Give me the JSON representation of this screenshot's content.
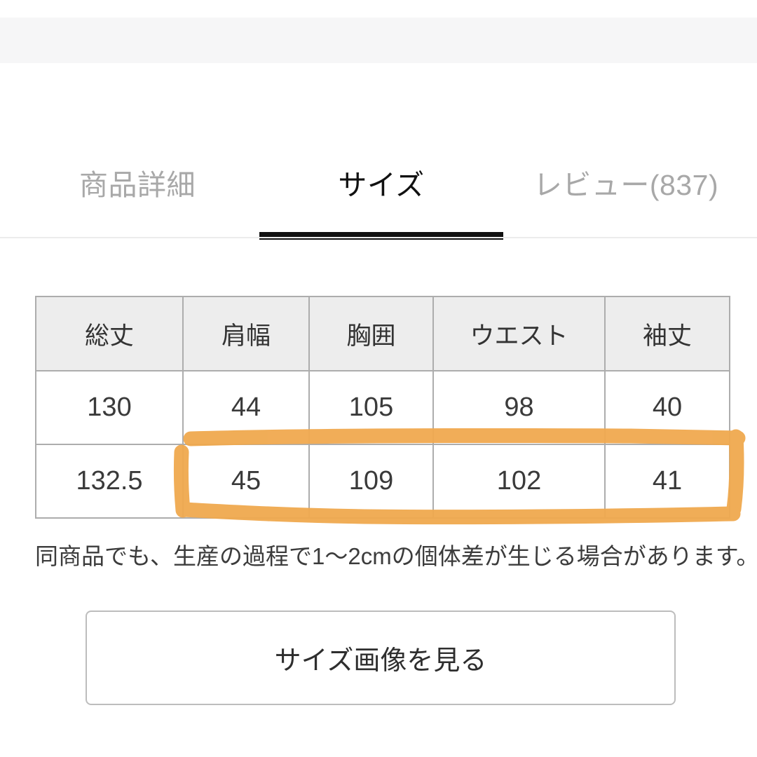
{
  "page": {
    "title": "商品サイズ",
    "background_color": "#ffffff"
  },
  "top_band": {
    "background_color": "#f6f6f7"
  },
  "tabs": {
    "active_index": 1,
    "active_color": "#111111",
    "inactive_color": "#a8a8a8",
    "items": [
      {
        "label": "商品詳細",
        "active": false
      },
      {
        "label": "サイズ",
        "active": true
      },
      {
        "label": "レビュー(837)",
        "active": false
      }
    ]
  },
  "size_table": {
    "headers": [
      "総丈",
      "肩幅",
      "胸囲",
      "ウエスト",
      "袖丈"
    ],
    "rows": [
      [
        "130",
        "44",
        "105",
        "98",
        "40"
      ],
      [
        "132.5",
        "45",
        "109",
        "102",
        "41"
      ]
    ],
    "header_background": "#ededed",
    "border_color": "#adadad"
  },
  "annotation": {
    "type": "hand-drawn-rectangle",
    "color": "#f0a94f",
    "description": "手書きのオレンジ枠（2行目の肩幅〜袖丈を囲む）"
  },
  "note": {
    "text": "同商品でも、生産の過程で1〜2cmの個体差が生じる場合があります。"
  },
  "size_image_button": {
    "label": "サイズ画像を見る",
    "border_color": "#bdbdbd"
  }
}
